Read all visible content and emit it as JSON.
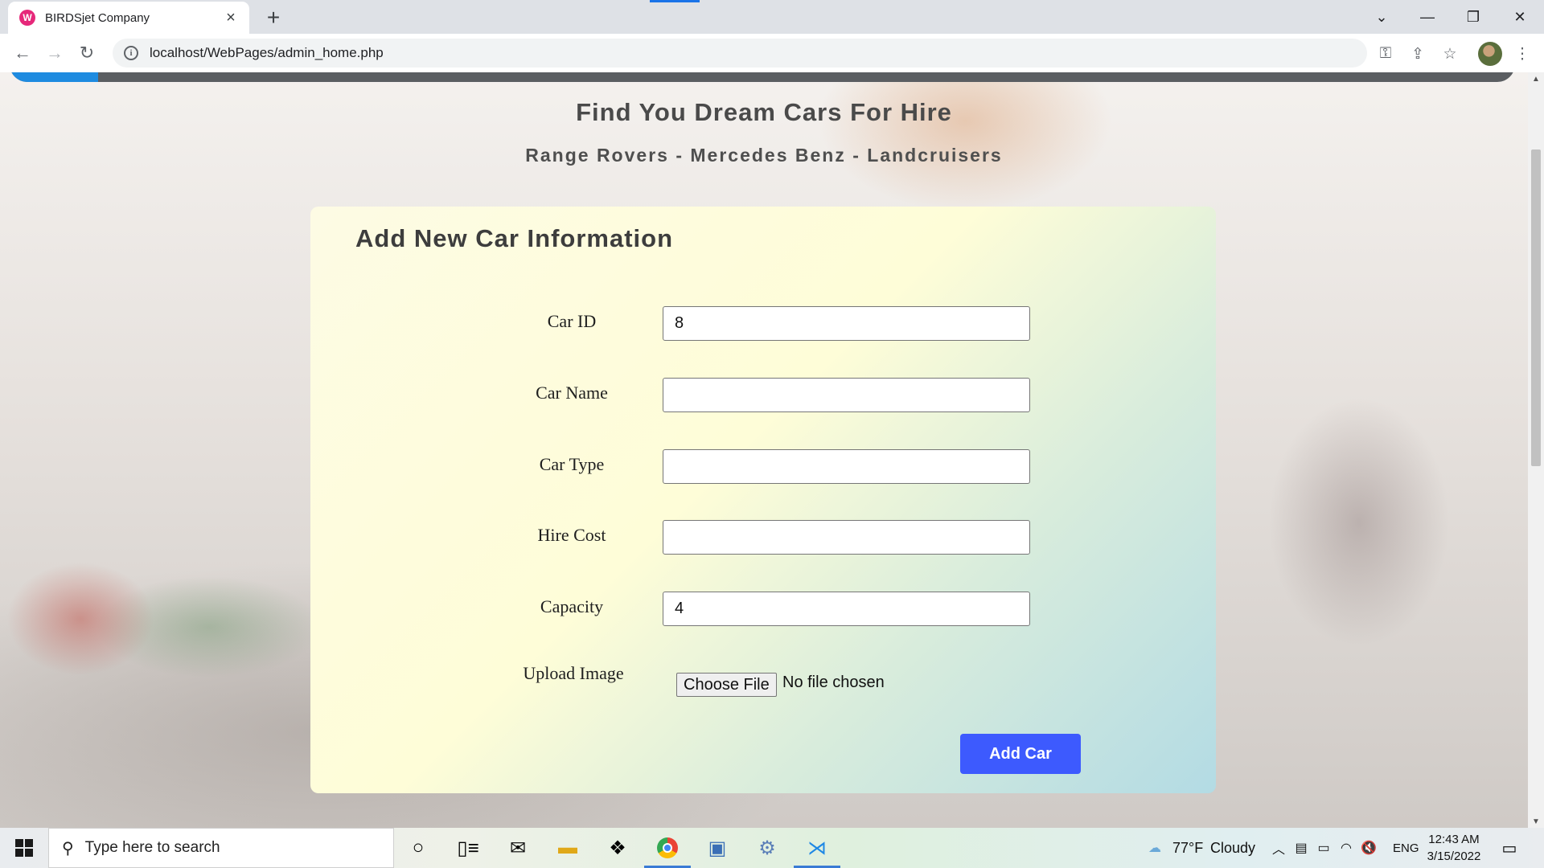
{
  "browser": {
    "tab_title": "BIRDSjet Company",
    "tab_favicon": "W",
    "url": "localhost/WebPages/admin_home.php"
  },
  "page": {
    "hero_title": "Find You Dream Cars For Hire",
    "hero_subtitle": "Range Rovers - Mercedes Benz - Landcruisers",
    "form": {
      "title": "Add New Car Information",
      "fields": [
        {
          "label": "Car ID",
          "value": "8"
        },
        {
          "label": "Car Name",
          "value": ""
        },
        {
          "label": "Car Type",
          "value": ""
        },
        {
          "label": "Hire Cost",
          "value": ""
        },
        {
          "label": "Capacity",
          "value": "4"
        }
      ],
      "upload_label": "Upload Image",
      "file_button": "Choose File",
      "file_status": "No file chosen",
      "submit_label": "Add Car"
    }
  },
  "taskbar": {
    "search_placeholder": "Type here to search",
    "weather_temp": "77°F",
    "weather_cond": "Cloudy",
    "language": "ENG",
    "time": "12:43 AM",
    "date": "3/15/2022",
    "apps": [
      "cortana-icon",
      "task-view-icon",
      "mail-icon",
      "file-explorer-icon",
      "dropbox-icon",
      "chrome-icon",
      "app-icon",
      "settings-icon",
      "vscode-icon"
    ]
  },
  "colors": {
    "accent": "#3d5afe",
    "nav_active": "#1e8be0",
    "nav_bar": "#5b5e62"
  }
}
